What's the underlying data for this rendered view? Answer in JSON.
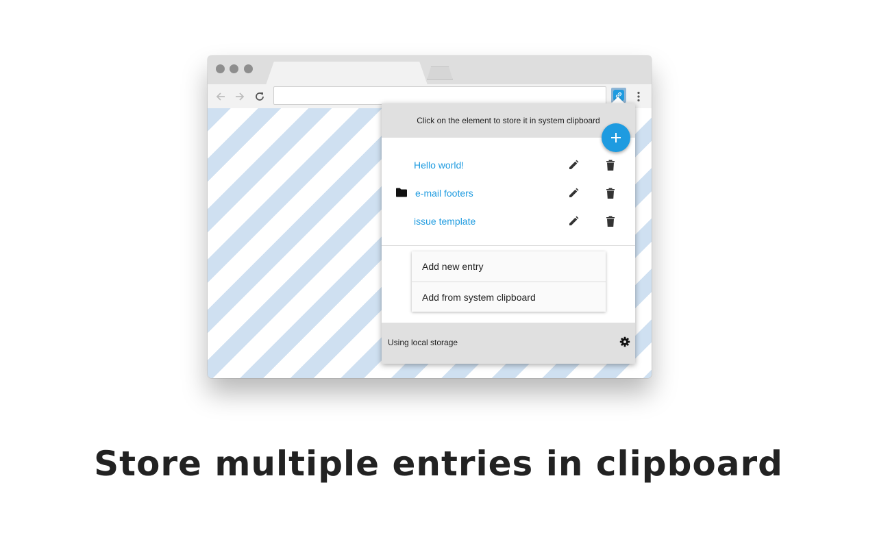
{
  "popup": {
    "header_text": "Click on the element to store it in system clipboard",
    "add_fab_icon": "plus-icon",
    "entries": [
      {
        "label": "Hello world!",
        "type": "entry"
      },
      {
        "label": "e-mail footers",
        "type": "folder"
      },
      {
        "label": "issue template",
        "type": "entry"
      }
    ],
    "add_menu": {
      "items": [
        "Add new entry",
        "Add from system clipboard"
      ]
    },
    "footer": {
      "storage_text": "Using local storage",
      "settings_icon": "gear-icon"
    }
  },
  "caption": "Store multiple entries in clipboard",
  "colors": {
    "accent": "#1e9be0",
    "stripe": "#cfe0f1",
    "header_bg": "#e0e0e0"
  }
}
